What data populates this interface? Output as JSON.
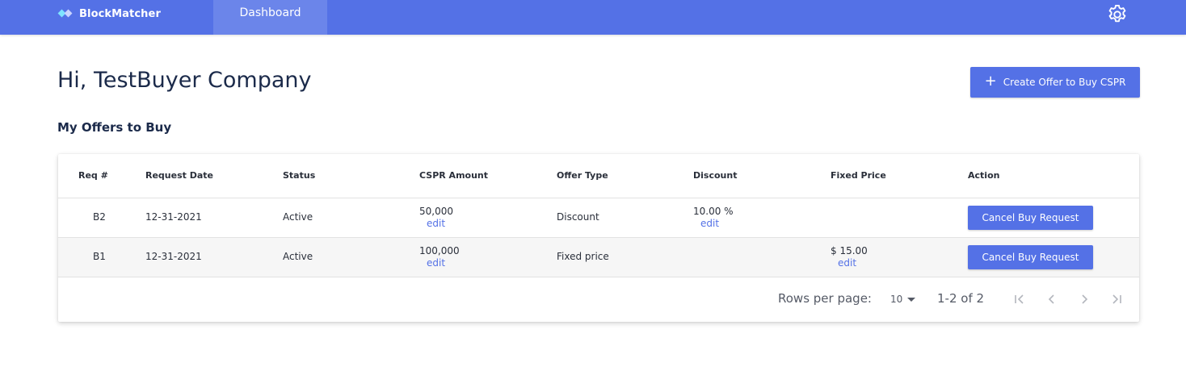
{
  "header": {
    "brand": "BlockMatcher",
    "nav_tab": "Dashboard",
    "brand_colors": {
      "bar": "#5471e6",
      "mark_a": "#7fe3ff",
      "mark_b": "#c9d3ff"
    }
  },
  "main": {
    "greeting": "Hi, TestBuyer Company",
    "create_button": "Create Offer to Buy CSPR",
    "section_title": "My Offers to Buy"
  },
  "table": {
    "columns": [
      "Req #",
      "Request Date",
      "Status",
      "CSPR Amount",
      "Offer Type",
      "Discount",
      "Fixed Price",
      "Action"
    ],
    "rows": [
      {
        "req": "B2",
        "date": "12-31-2021",
        "status": "Active",
        "amount": "50,000",
        "amount_edit": "edit",
        "offer_type": "Discount",
        "discount": "10.00 %",
        "discount_edit": "edit",
        "fixed_price": "",
        "fixed_edit": "",
        "action": "Cancel Buy Request"
      },
      {
        "req": "B1",
        "date": "12-31-2021",
        "status": "Active",
        "amount": "100,000",
        "amount_edit": "edit",
        "offer_type": "Fixed price",
        "discount": "",
        "discount_edit": "",
        "fixed_price": "$ 15.00",
        "fixed_edit": "edit",
        "action": "Cancel Buy Request"
      }
    ]
  },
  "pagination": {
    "rows_per_page_label": "Rows per page:",
    "rows_per_page_value": "10",
    "range": "1-2 of 2",
    "icons": [
      "first-page-icon",
      "previous-page-icon",
      "next-page-icon",
      "last-page-icon"
    ]
  }
}
